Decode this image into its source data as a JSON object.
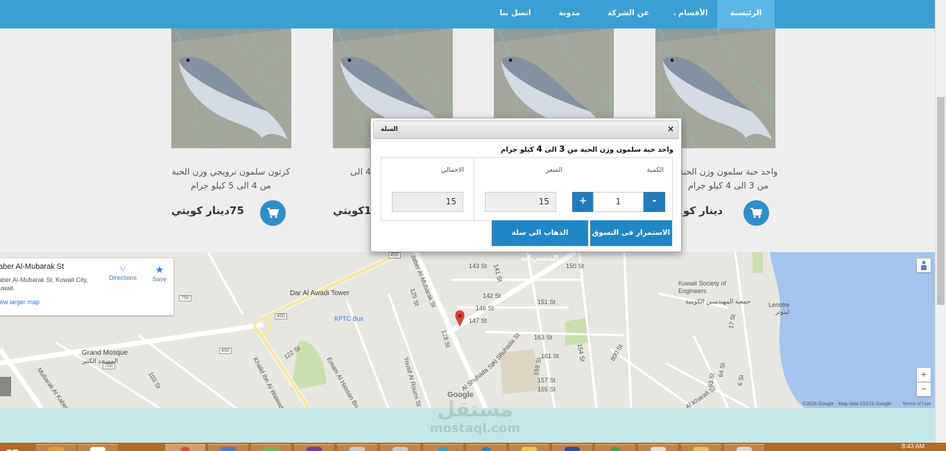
{
  "nav": {
    "items": [
      {
        "label": "الرئيسية",
        "active": true
      },
      {
        "label": "الأقسام",
        "dropdown": true
      },
      {
        "label": "عن الشركة"
      },
      {
        "label": "مدونة"
      },
      {
        "label": "اتصل بنا"
      }
    ]
  },
  "products": [
    {
      "name": "كرتون سلمون نرويجي وزن الحبة من 4 الى 5 كيلو جرام",
      "price": "75دينار كويتي"
    },
    {
      "name": "... من 4 الى",
      "price": "18كويتي"
    },
    {
      "name": "",
      "price": ""
    },
    {
      "name": "واحد حبة سلمون وزن الحبة من 3 الى 4 كيلو جرام",
      "price": "دينار كو"
    }
  ],
  "modal": {
    "title": "السلة",
    "close": "×",
    "description_parts": [
      "واحد حبة سلمون وزن الحبة من ",
      "3",
      " الى ",
      "4",
      " كيلو جرام"
    ],
    "headers": {
      "quantity": "الكمية",
      "price": "السعر",
      "total": "الاجمالي"
    },
    "quantity": "1",
    "price": "15",
    "total": "15",
    "minus": "-",
    "plus": "+",
    "continue_button": "الاستمرار فى التسوق",
    "cart_button": "الذهاب الى سلة المشتريات"
  },
  "map": {
    "place_title": "aber Al-Mubarak St",
    "place_address": "aber Al-Mubarak St, Kuwait City, uwait",
    "larger_map": "iew larger map",
    "directions": "Directions",
    "save": "Save",
    "labels": {
      "dar_al_awadi": "Dar Al Awadi Tower",
      "kptc_bus": "KPTC Bus",
      "grand_mosque": "Grand Mosque",
      "grand_mosque_ar": "المسجد الكبير",
      "kuwait_society": "Kuwait Society of Engineers",
      "kuwait_society_ar": "جمعية المهندسين الكويتية",
      "lenotre": "Lenotre",
      "lenotre_ar": "لينوتر",
      "khalid_ibn": "Khalid Ibn Al Waleed St",
      "shuhada": "Al Shuhada St",
      "yousif": "Yousif Al Roumi St",
      "emam": "Emam Al Hassan Bn",
      "jaber": "Jaber Al-Mubarak St",
      "mubarak_kabeer": "Mubarak Al Kabeer St",
      "kharafi": "Al Kharafi St",
      "st_146": "146 St",
      "st_147": "147 St",
      "st_143": "143 St",
      "st_150": "150 St",
      "st_151": "151 St",
      "st_142": "142 St",
      "st_163": "163 St",
      "st_161": "161 St",
      "st_157": "157 St",
      "st_155": "155 St",
      "st_800": "800 St",
      "st_450": "450",
      "st_750": "750",
      "st_122": "122 St",
      "st_128": "128 St",
      "st_125": "125 St",
      "st_103": "103 St",
      "st_141": "141 St",
      "st_154": "154 St",
      "st_159": "159 St",
      "st_6": "6 St",
      "st_63": "63 St",
      "st_64": "64 St",
      "st_17": "17 St",
      "google": "Google",
      "copyright": "©2016 Google - Map data ©2016 Google",
      "terms": "Terms of Use"
    },
    "zoom_in": "+",
    "zoom_out": "−"
  },
  "watermark": {
    "ar": "مستقل",
    "en": "mostaql.com"
  },
  "taskbar": {
    "clock": "8:43 AM"
  },
  "colors": {
    "nav": "#3a9fd2",
    "primary_button": "#1f87c8",
    "cart_icon_bg": "#2b8fcc",
    "pin": "#d9433b"
  }
}
